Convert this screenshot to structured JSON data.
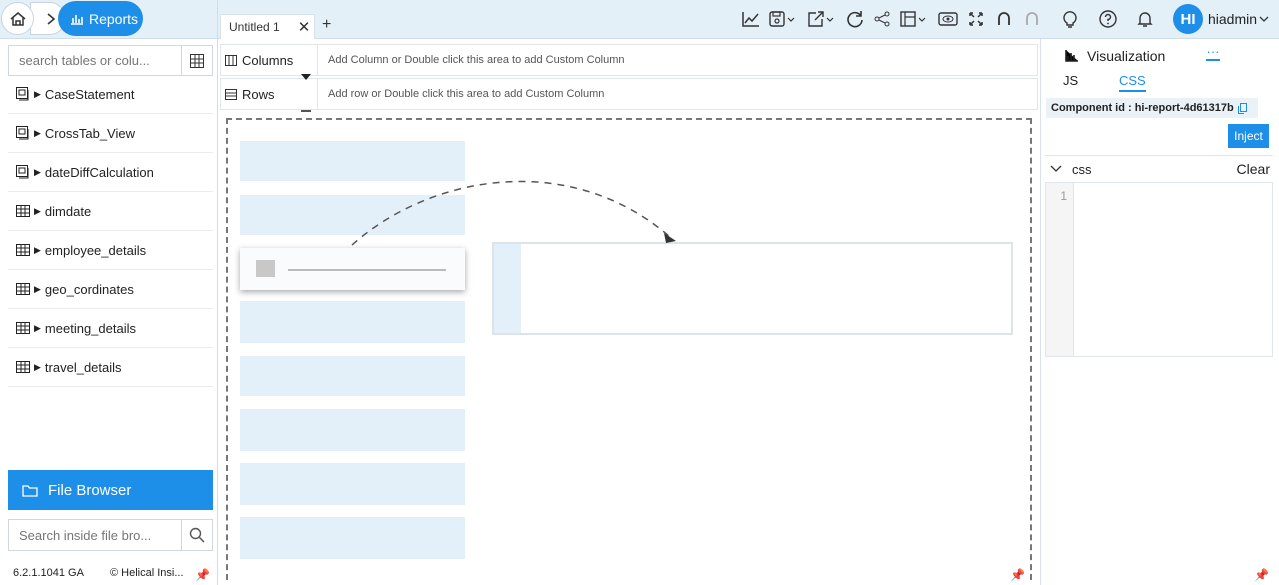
{
  "breadcrumb": {
    "reports_label": "Reports"
  },
  "tabs": [
    {
      "label": "Untitled 1"
    }
  ],
  "tab_add": "+",
  "user": {
    "initials": "HI",
    "name": "hiadmin"
  },
  "sidebar": {
    "search_placeholder": "search tables or colu...",
    "items": [
      {
        "label": "CaseStatement",
        "icon": "view-icon"
      },
      {
        "label": "CrossTab_View",
        "icon": "view-icon"
      },
      {
        "label": "dateDiffCalculation",
        "icon": "view-icon"
      },
      {
        "label": "dimdate",
        "icon": "table-icon"
      },
      {
        "label": "employee_details",
        "icon": "table-icon"
      },
      {
        "label": "geo_cordinates",
        "icon": "table-icon"
      },
      {
        "label": "meeting_details",
        "icon": "table-icon"
      },
      {
        "label": "travel_details",
        "icon": "table-icon"
      }
    ],
    "file_browser_label": "File Browser",
    "file_search_placeholder": "Search inside file bro...",
    "version": "6.2.1.1041 GA",
    "copyright": "© Helical Insi..."
  },
  "shelves": {
    "columns_label": "Columns",
    "columns_hint": "Add Column or Double click this area to add Custom Column",
    "rows_label": "Rows",
    "rows_hint": "Add row or Double click this area to add Custom Column"
  },
  "right_panel": {
    "title": "Visualization",
    "more": "···",
    "tab_js": "JS",
    "tab_css": "CSS",
    "component_id": "Component id : hi-report-4d61317b",
    "inject_label": "Inject",
    "section_label": "css",
    "clear_label": "Clear",
    "line_number": "1"
  },
  "colors": {
    "accent": "#1e8fe8",
    "topbar": "#e4f0f8",
    "placeholder": "#e3eff9"
  }
}
